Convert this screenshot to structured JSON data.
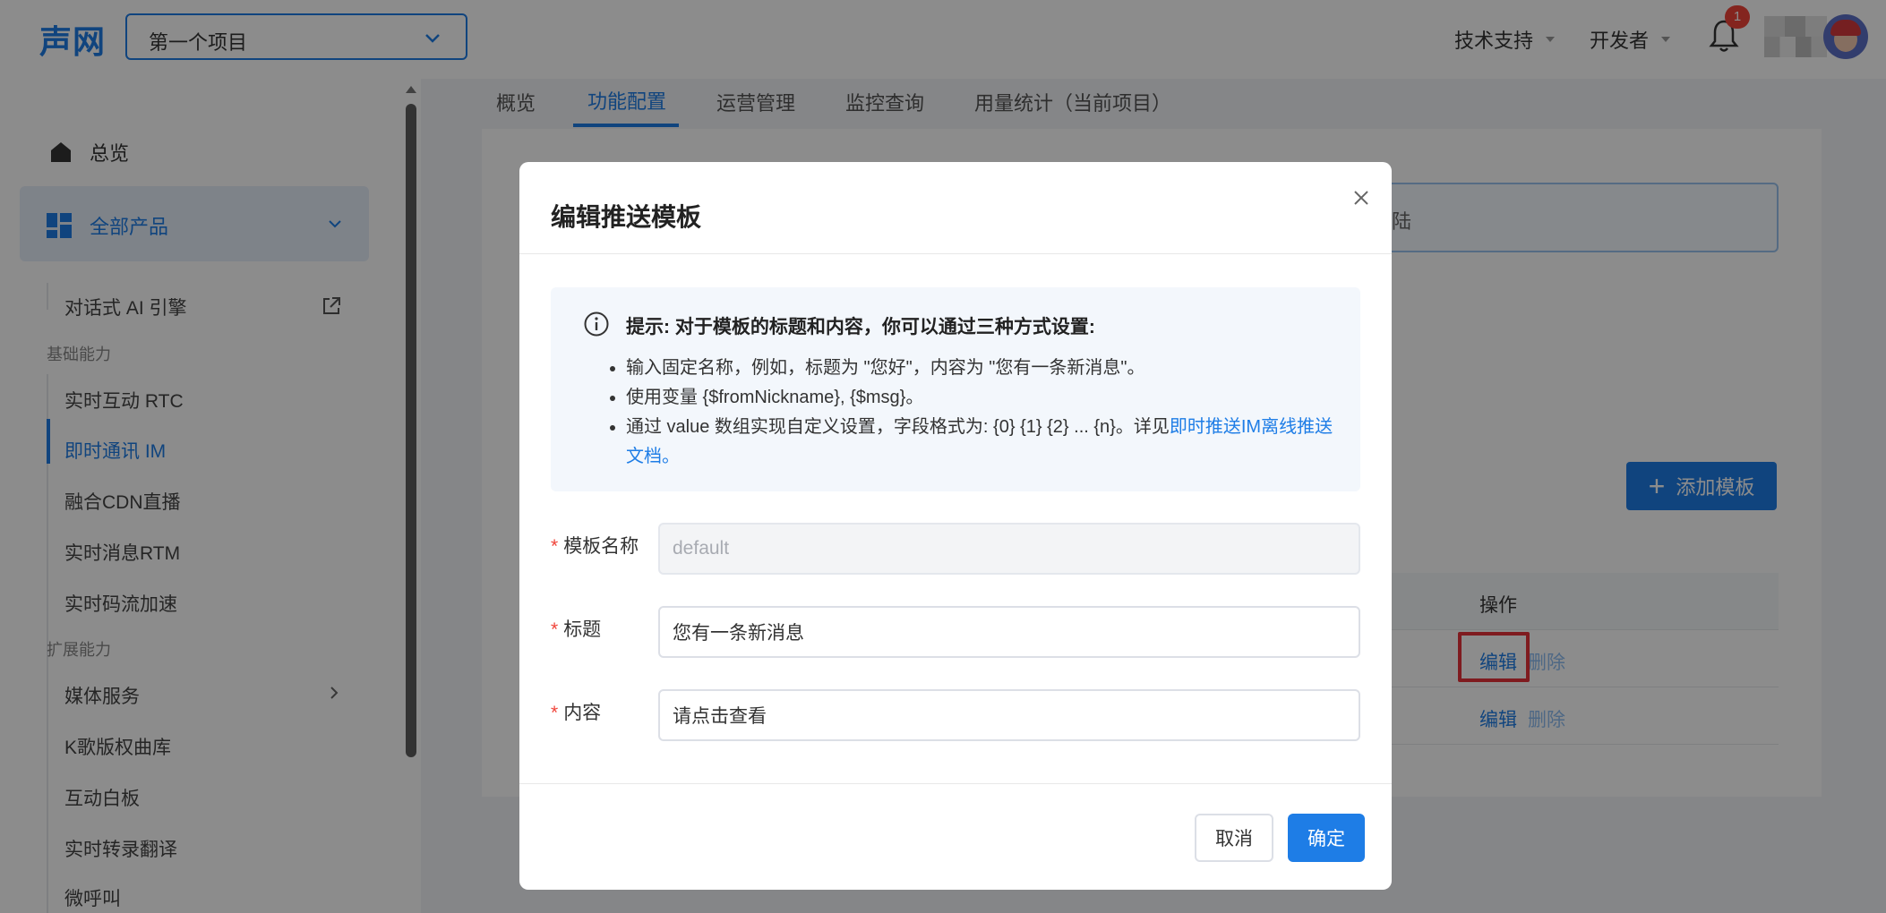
{
  "header": {
    "logo": "声网",
    "project_select": {
      "value": "第一个项目"
    },
    "tech_support": "技术支持",
    "developer": "开发者",
    "notification_count": "1"
  },
  "sidebar": {
    "overview": "总览",
    "all_products": "全部产品",
    "items": [
      {
        "label": "对话式 AI 引擎"
      },
      {
        "label": "实时互动 RTC"
      },
      {
        "label": "即时通讯 IM"
      },
      {
        "label": "融合CDN直播"
      },
      {
        "label": "实时消息RTM"
      },
      {
        "label": "实时码流加速"
      },
      {
        "label": "媒体服务"
      },
      {
        "label": "K歌版权曲库"
      },
      {
        "label": "互动白板"
      },
      {
        "label": "实时转录翻译"
      },
      {
        "label": "微呼叫"
      }
    ],
    "sections": {
      "basic": "基础能力",
      "extended": "扩展能力"
    }
  },
  "main": {
    "tabs": [
      {
        "label": "概览"
      },
      {
        "label": "功能配置"
      },
      {
        "label": "运营管理"
      },
      {
        "label": "监控查询"
      },
      {
        "label": "用量统计（当前项目）"
      }
    ],
    "active_tab": "功能配置",
    "bg_input_fragment": "陆",
    "add_template_button": "添加模板",
    "table": {
      "action_header": "操作",
      "rows": [
        {
          "edit": "编辑",
          "delete": "删除"
        },
        {
          "edit": "编辑",
          "delete": "删除"
        }
      ]
    }
  },
  "modal": {
    "title": "编辑推送模板",
    "tip": {
      "heading": "提示: 对于模板的标题和内容，你可以通过三种方式设置:",
      "line1": "输入固定名称，例如，标题为 \"您好\"，内容为 \"您有一条新消息\"。",
      "line2": "使用变量 {$fromNickname}, {$msg}。",
      "line3_prefix": "通过 value 数组实现自定义设置，字段格式为: {0} {1} {2} ... {n}。详见",
      "line3_link": "即时推送IM离线推送文档",
      "line3_suffix": "。"
    },
    "fields": {
      "name": {
        "label": "模板名称",
        "value": "default"
      },
      "title": {
        "label": "标题",
        "value": "您有一条新消息"
      },
      "content": {
        "label": "内容",
        "value": "请点击查看"
      }
    },
    "cancel_button": "取消",
    "confirm_button": "确定"
  },
  "colors": {
    "accent": "#1e7de6",
    "danger": "#f0443a",
    "overlay": "rgba(0,0,0,0.45)"
  }
}
